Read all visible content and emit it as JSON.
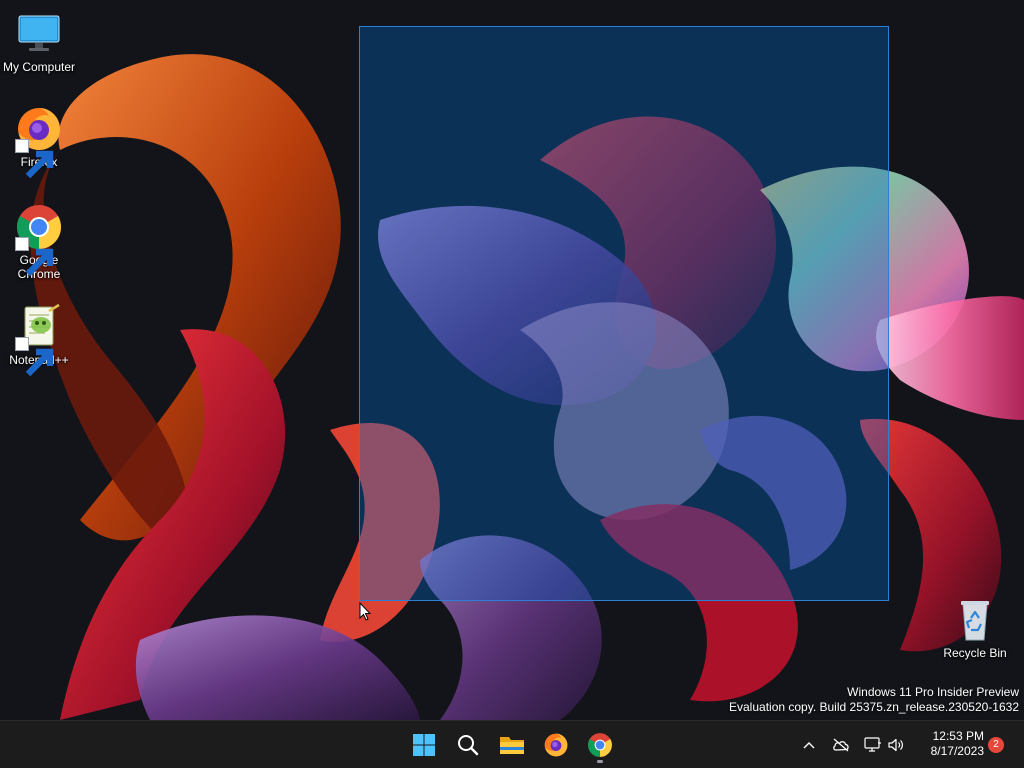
{
  "desktop": {
    "icons": [
      {
        "label": "My Computer",
        "icon": "monitor-icon"
      },
      {
        "label": "Firefox",
        "icon": "firefox-icon"
      },
      {
        "label": "Google Chrome",
        "icon": "chrome-icon"
      },
      {
        "label": "Notepad++",
        "icon": "notepadpp-icon"
      },
      {
        "label": "Recycle Bin",
        "icon": "recycle-bin-icon"
      }
    ],
    "watermark": {
      "line1": "Windows 11 Pro Insider Preview",
      "line2": "Evaluation copy. Build 25375.zn_release.230520-1632"
    },
    "selection_rectangle": true
  },
  "taskbar": {
    "pinned": [
      {
        "name": "start",
        "icon": "windows-logo-icon"
      },
      {
        "name": "search",
        "icon": "search-icon"
      },
      {
        "name": "file-explorer",
        "icon": "folder-icon"
      },
      {
        "name": "firefox",
        "icon": "firefox-icon"
      },
      {
        "name": "chrome",
        "icon": "chrome-icon",
        "running": true
      }
    ],
    "tray": {
      "icons": [
        "chevron-up-icon",
        "cloud-offline-icon",
        "network-icon",
        "speaker-icon"
      ],
      "time": "12:53 PM",
      "date": "8/17/2023",
      "notification_count": "2"
    }
  },
  "colors": {
    "selection_fill": "#0066cc",
    "selection_border": "#2d7fd6",
    "taskbar_bg": "#1c1c1c",
    "badge": "#e8483c"
  }
}
